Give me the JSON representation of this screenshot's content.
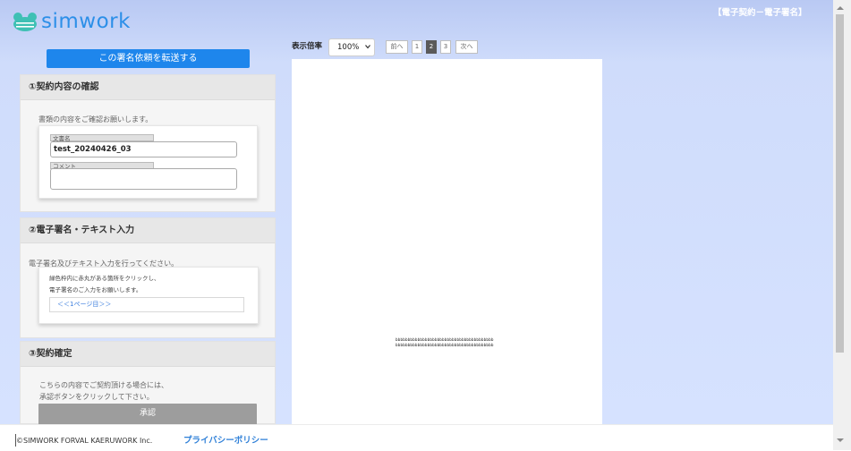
{
  "header": {
    "logo_text": "simwork",
    "title": "【電子契約－電子署名】"
  },
  "sidebar": {
    "forward_button": "この署名依頼を転送する",
    "section1": {
      "title": "①契約内容の確認",
      "description": "書類の内容をご確認お願いします。",
      "doc_name_label": "文書名",
      "doc_name_value": "test_20240426_03",
      "comment_label": "コメント",
      "comment_value": ""
    },
    "section2": {
      "title": "②電子署名・テキスト入力",
      "description": "電子署名及びテキスト入力を行ってください。",
      "instruction1": "緑色枠内に赤丸がある箇所をクリックし、",
      "instruction2": "電子署名のご入力をお願いします。",
      "page_link": "＜＜1ページ目＞＞"
    },
    "section3": {
      "title": "③契約確定",
      "description1": "こちらの内容でご契約頂ける場合には、",
      "description2": "承認ボタンをクリックして下さい。",
      "approve_button": "承認"
    }
  },
  "viewer": {
    "zoom_label": "表示倍率",
    "zoom_value": "100%",
    "prev_label": "前へ",
    "next_label": "次へ",
    "pages": [
      "1",
      "2",
      "3"
    ],
    "current_page": "2",
    "doc_lines": [
      "bbbbbbbbbbbbbbbbbbbbbbbbbbbbbbbbbbbbbbbb",
      "bbbbbbbbbbbbbbbbbbbbbbbbbbbbbbbbbbbbbbbb"
    ]
  },
  "footer": {
    "copyright": "©SIMWORK FORVAL KAERUWORK Inc.",
    "privacy": "プライバシーポリシー"
  },
  "colors": {
    "accent": "#1e86ec",
    "logo": "#2c8fe8",
    "approve_disabled": "#9d9d9d",
    "link": "#2f80d8"
  }
}
